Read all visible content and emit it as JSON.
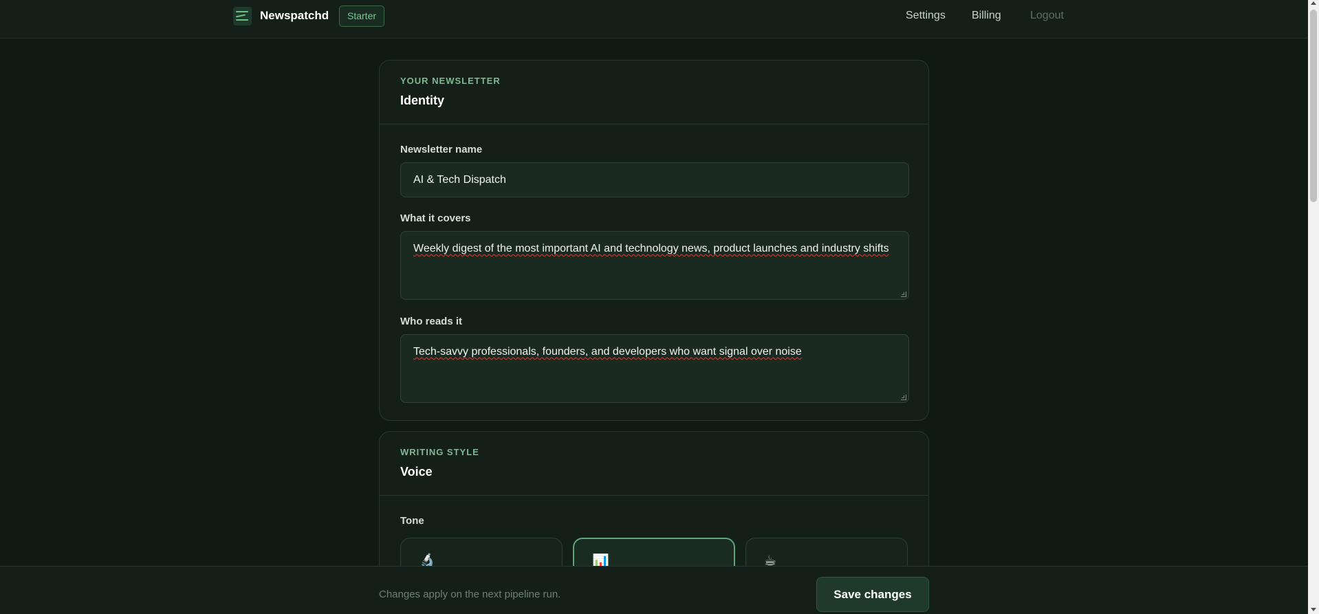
{
  "nav": {
    "brand": "Newspatchd",
    "plan_badge": "Starter",
    "links": {
      "settings": "Settings",
      "billing": "Billing",
      "logout": "Logout"
    }
  },
  "identity": {
    "eyebrow": "YOUR NEWSLETTER",
    "title": "Identity",
    "name_label": "Newsletter name",
    "name_value": "AI & Tech Dispatch",
    "covers_label": "What it covers",
    "covers_value": "Weekly digest of the most important AI and technology news, product launches and industry shifts",
    "readers_label": "Who reads it",
    "readers_value": "Tech-savvy professionals, founders, and developers who want signal over noise"
  },
  "voice": {
    "eyebrow": "WRITING STYLE",
    "title": "Voice",
    "tone_label": "Tone",
    "tones": [
      {
        "icon": "🔬",
        "icon_name": "microscope-icon",
        "selected": false
      },
      {
        "icon": "📊",
        "icon_name": "bar-chart-icon",
        "selected": true
      },
      {
        "icon": "☕",
        "icon_name": "coffee-icon",
        "selected": false
      }
    ]
  },
  "savebar": {
    "hint": "Changes apply on the next pipeline run.",
    "save_label": "Save changes"
  },
  "colors": {
    "background": "#0f1a14",
    "card": "#141f18",
    "accent": "#7fb894",
    "save_button": "#1f3a2a"
  }
}
